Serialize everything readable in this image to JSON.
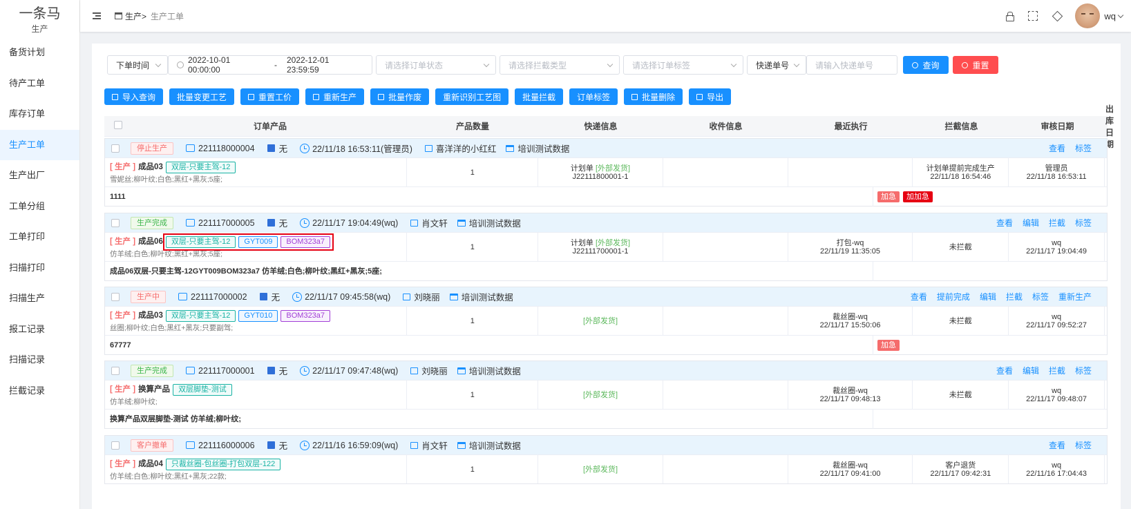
{
  "brand": {
    "name": "一条马",
    "sub": "生产"
  },
  "nav": [
    "备货计划",
    "待产工单",
    "库存订单",
    "生产工单",
    "生产出厂",
    "工单分组",
    "工单打印",
    "扫描打印",
    "扫描生产",
    "报工记录",
    "扫描记录",
    "拦截记录"
  ],
  "nav_active": 3,
  "breadcrumb": {
    "c1": "生产>",
    "c2": "生产工单"
  },
  "user": {
    "name": "wq"
  },
  "filters": {
    "time_type": "下单时间",
    "date_start": "2022-10-01 00:00:00",
    "date_sep": "-",
    "date_end": "2022-12-01 23:59:59",
    "status_ph": "请选择订单状态",
    "intercept_ph": "请选择拦截类型",
    "tag_ph": "请选择订单标签",
    "express_type": "快递单号",
    "express_ph": "请输入快递单号",
    "query": "查询",
    "reset": "重置"
  },
  "actions": [
    "导入查询",
    "批量变更工艺",
    "重置工价",
    "重新生产",
    "批量作废",
    "重新识别工艺图",
    "批量拦截",
    "订单标签",
    "批量删除",
    "导出"
  ],
  "columns": [
    "订单产品",
    "产品数量",
    "快递信息",
    "收件信息",
    "最近执行",
    "拦截信息",
    "审核日期",
    "出库日期"
  ],
  "orders": [
    {
      "status": "停止生产",
      "status_cls": "st-stop",
      "no": "221118000004",
      "remark": "无",
      "time": "22/11/18 16:53:11(管理员)",
      "shop": "喜洋洋的小红红",
      "data": "培训测试数据",
      "links": [
        "查看",
        "标签"
      ],
      "kind": "[ 生产 ]",
      "product": "成品03",
      "tags": [
        {
          "text": "双层-只要主驾-12",
          "cls": "tg-green"
        }
      ],
      "sub": "雪妮丝;柳叶纹;白色;黑红+黑灰;5座;",
      "qty": "1",
      "express1": "计划单 ",
      "express1b": "[外部发货]",
      "express2": "J22111800001-1",
      "recv": "",
      "exec1": "",
      "exec2": "",
      "intercept1": "计划单提前完成生产",
      "intercept2": "22/11/18 16:54:46",
      "audit1": "管理员",
      "audit2": "22/11/18 16:53:11",
      "out": "",
      "note": "1111",
      "urgent": [
        {
          "text": "加急",
          "cls": "ub-l"
        },
        {
          "text": "加加急",
          "cls": "ub-d"
        }
      ]
    },
    {
      "status": "生产完成",
      "status_cls": "st-done",
      "no": "221117000005",
      "remark": "无",
      "time": "22/11/17 19:04:49(wq)",
      "shop": "肖文轩",
      "data": "培训测试数据",
      "links": [
        "查看",
        "编辑",
        "拦截",
        "标签"
      ],
      "kind": "[ 生产 ]",
      "product": "成品06",
      "tags": [
        {
          "text": "双层-只要主驾-12",
          "cls": "tg-green"
        },
        {
          "text": "GYT009",
          "cls": "tg-blue"
        },
        {
          "text": "BOM323a7",
          "cls": "tg-purple"
        }
      ],
      "sub": "仿羊绒;白色;柳叶纹;黑红+黑灰;5座;",
      "qty": "1",
      "express1": "计划单 ",
      "express1b": "[外部发货]",
      "express2": "J22111700001-1",
      "recv": "",
      "exec1": "打包-wq",
      "exec2": "22/11/19 11:35:05",
      "intercept1": "未拦截",
      "intercept2": "",
      "audit1": "wq",
      "audit2": "22/11/17 19:04:49",
      "out": "",
      "note": "成品06双层-只要主驾-12GYT009BOM323a7 仿羊绒;白色;柳叶纹;黑红+黑灰;5座;",
      "urgent": []
    },
    {
      "status": "生产中",
      "status_cls": "st-ing",
      "no": "221117000002",
      "remark": "无",
      "time": "22/11/17 09:45:58(wq)",
      "shop": "刘晓丽",
      "data": "培训测试数据",
      "links": [
        "查看",
        "提前完成",
        "编辑",
        "拦截",
        "标签",
        "重新生产"
      ],
      "kind": "[ 生产 ]",
      "product": "成品03",
      "tags": [
        {
          "text": "双层-只要主驾-12",
          "cls": "tg-green"
        },
        {
          "text": "GYT010",
          "cls": "tg-blue"
        },
        {
          "text": "BOM323a7",
          "cls": "tg-purple"
        }
      ],
      "sub": "丝圈;柳叶纹;白色;黑红+黑灰;只要副驾;",
      "qty": "1",
      "express1": "",
      "express1b": "[外部发货]",
      "express2": "",
      "recv": "",
      "exec1": "裁丝圈-wq",
      "exec2": "22/11/17 15:50:06",
      "intercept1": "未拦截",
      "intercept2": "",
      "audit1": "wq",
      "audit2": "22/11/17 09:52:27",
      "out": "",
      "note": "67777",
      "urgent": [
        {
          "text": "加急",
          "cls": "ub-l"
        }
      ]
    },
    {
      "status": "生产完成",
      "status_cls": "st-done",
      "no": "221117000001",
      "remark": "无",
      "time": "22/11/17 09:47:48(wq)",
      "shop": "刘晓丽",
      "data": "培训测试数据",
      "links": [
        "查看",
        "编辑",
        "拦截",
        "标签"
      ],
      "kind": "[ 生产 ]",
      "product": "换算产品",
      "tags": [
        {
          "text": "双层脚垫-测试",
          "cls": "tg-green"
        }
      ],
      "sub": "仿羊绒;柳叶纹;",
      "qty": "1",
      "express1": "",
      "express1b": "[外部发货]",
      "express2": "",
      "recv": "",
      "exec1": "裁丝圈-wq",
      "exec2": "22/11/17 09:48:13",
      "intercept1": "未拦截",
      "intercept2": "",
      "audit1": "wq",
      "audit2": "22/11/17 09:48:07",
      "out": "",
      "note": "换算产品双层脚垫-测试 仿羊绒;柳叶纹;",
      "urgent": []
    },
    {
      "status": "客户撤单",
      "status_cls": "st-cancel",
      "no": "221116000006",
      "remark": "无",
      "time": "22/11/16 16:59:09(wq)",
      "shop": "肖文轩",
      "data": "培训测试数据",
      "links": [
        "查看",
        "标签"
      ],
      "kind": "[ 生产 ]",
      "product": "成品04",
      "tags": [
        {
          "text": "只裁丝圈-包丝圈-打包双层-122",
          "cls": "tg-green"
        }
      ],
      "sub": "仿羊绒;白色;柳叶纹;黑红+黑灰;22款;",
      "qty": "1",
      "express1": "",
      "express1b": "[外部发货]",
      "express2": "",
      "recv": "",
      "exec1": "裁丝圈-wq",
      "exec2": "22/11/17 09:41:00",
      "intercept1": "客户退货",
      "intercept2": "22/11/17 09:42:31",
      "audit1": "wq",
      "audit2": "22/11/16 17:04:43",
      "out": "",
      "note": "",
      "urgent": []
    }
  ]
}
